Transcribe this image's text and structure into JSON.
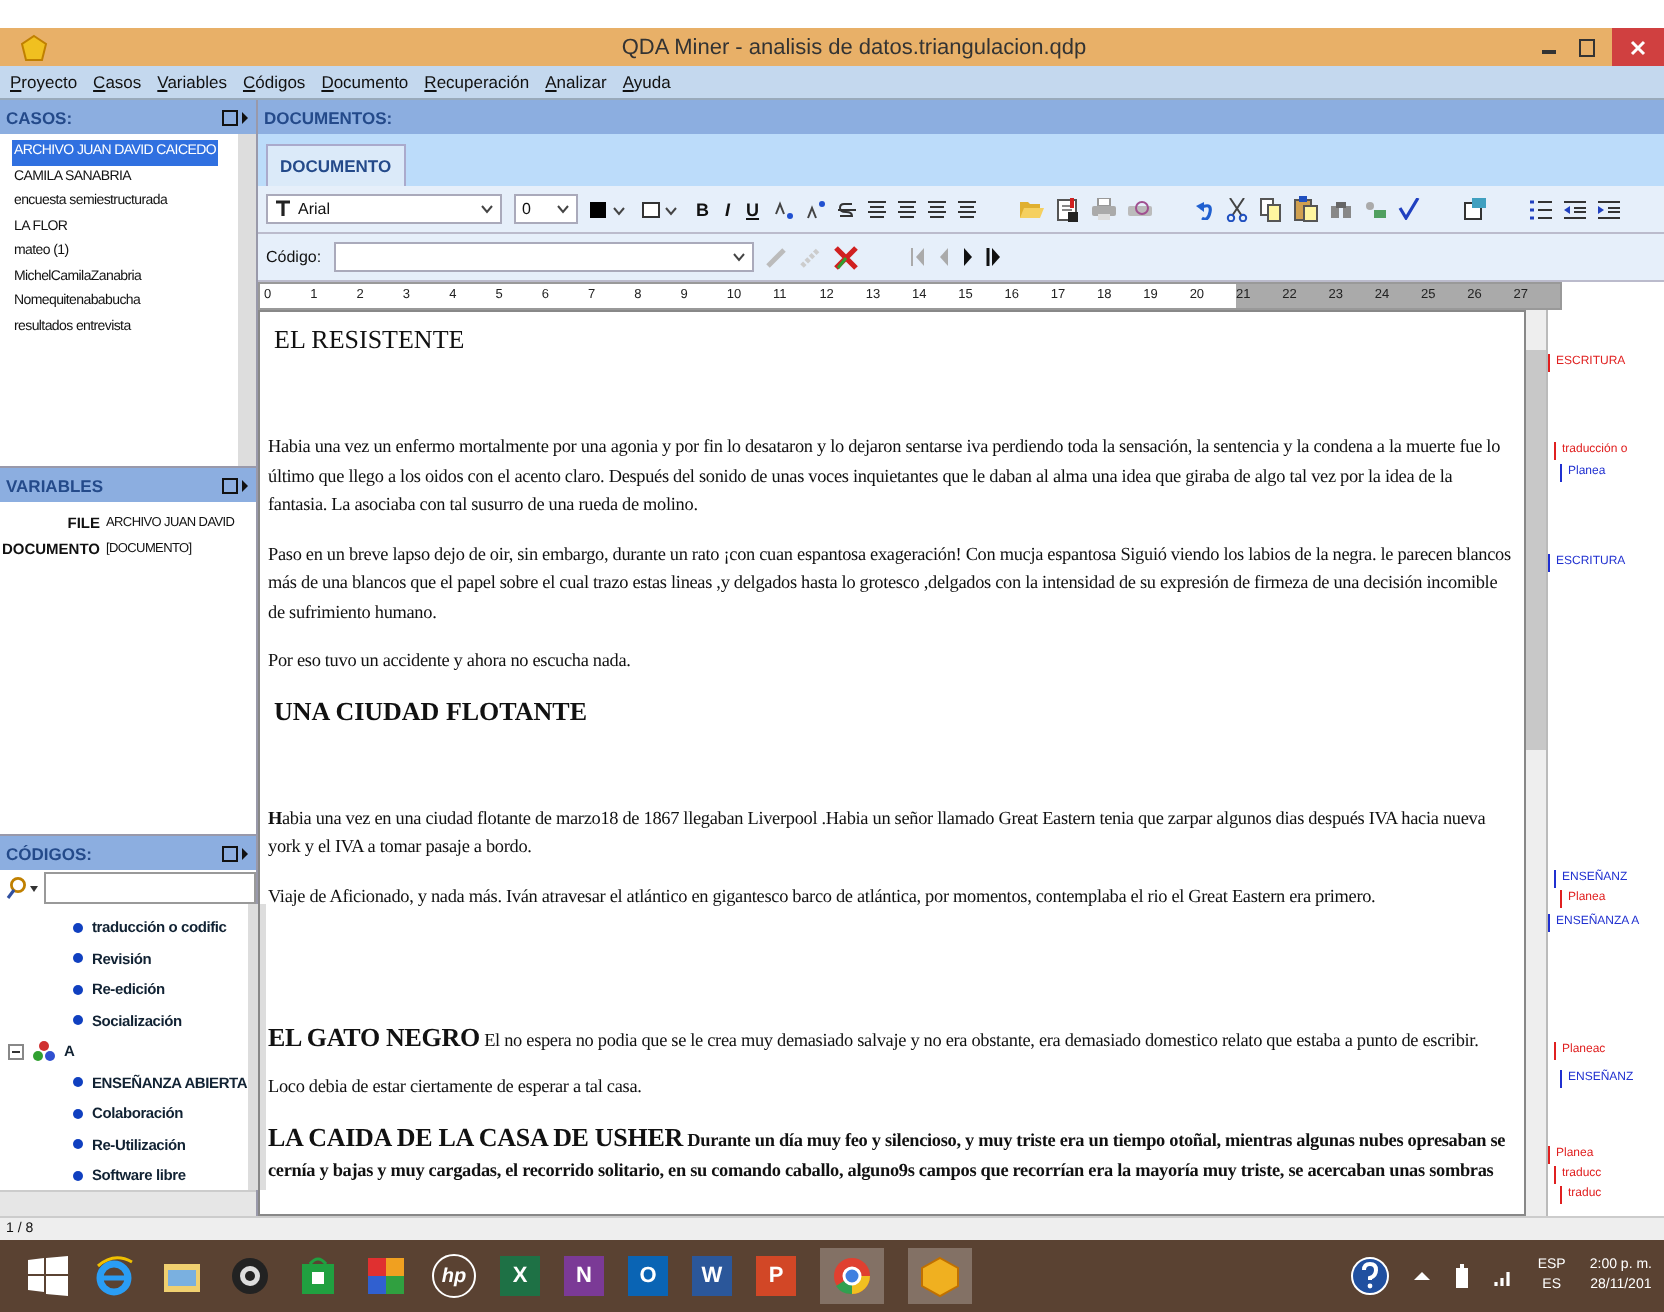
{
  "window": {
    "title": "QDA Miner - analisis de datos.triangulacion.qdp"
  },
  "menu": [
    "Proyecto",
    "Casos",
    "Variables",
    "Códigos",
    "Documento",
    "Recuperación",
    "Analizar",
    "Ayuda"
  ],
  "cases": {
    "title": "CASOS:",
    "items": [
      {
        "label": "ARCHIVO JUAN DAVID CAICEDO",
        "selected": true
      },
      {
        "label": "CAMILA SANABRIA",
        "selected": false
      },
      {
        "label": "encuesta semiestructurada",
        "selected": false
      },
      {
        "label": "LA FLOR",
        "selected": false
      },
      {
        "label": "mateo (1)",
        "selected": false
      },
      {
        "label": "MichelCamilaZanabria",
        "selected": false
      },
      {
        "label": "Nomequitenababucha",
        "selected": false
      },
      {
        "label": "resultados entrevista",
        "selected": false
      }
    ]
  },
  "variables": {
    "title": "VARIABLES",
    "rows": [
      {
        "name": "FILE",
        "value": "ARCHIVO JUAN DAVID"
      },
      {
        "name": "DOCUMENTO",
        "value": "[DOCUMENTO]"
      }
    ]
  },
  "codes": {
    "title": "CÓDIGOS:",
    "items": [
      {
        "label": "traducción o codific",
        "kind": "code"
      },
      {
        "label": "Revisión",
        "kind": "code"
      },
      {
        "label": "Re-edición",
        "kind": "code"
      },
      {
        "label": "Socialización",
        "kind": "code"
      },
      {
        "label": "A",
        "kind": "category",
        "expanded": true,
        "children": [
          {
            "label": "ENSEÑANZA ABIERTA",
            "kind": "code"
          },
          {
            "label": "Colaboración",
            "kind": "code"
          },
          {
            "label": "Re-Utilización",
            "kind": "code"
          },
          {
            "label": "Software libre",
            "kind": "code"
          }
        ]
      }
    ]
  },
  "documents": {
    "title": "DOCUMENTOS:",
    "tabs": [
      {
        "label": "DOCUMENTO",
        "selected": true
      }
    ]
  },
  "toolbar": {
    "font": "Arial",
    "size": "0",
    "format_buttons": [
      "B",
      "I",
      "U"
    ],
    "code_label": "Código:"
  },
  "ruler": [
    {
      "label": "0",
      "shaded": false
    },
    {
      "label": "1",
      "shaded": false
    },
    {
      "label": "2",
      "shaded": false
    },
    {
      "label": "3",
      "shaded": false
    },
    {
      "label": "4",
      "shaded": false
    },
    {
      "label": "5",
      "shaded": false
    },
    {
      "label": "6",
      "shaded": false
    },
    {
      "label": "7",
      "shaded": false
    },
    {
      "label": "8",
      "shaded": false
    },
    {
      "label": "9",
      "shaded": false
    },
    {
      "label": "10",
      "shaded": false
    },
    {
      "label": "11",
      "shaded": false
    },
    {
      "label": "12",
      "shaded": false
    },
    {
      "label": "13",
      "shaded": false
    },
    {
      "label": "14",
      "shaded": false
    },
    {
      "label": "15",
      "shaded": false
    },
    {
      "label": "16",
      "shaded": false
    },
    {
      "label": "17",
      "shaded": false
    },
    {
      "label": "18",
      "shaded": false
    },
    {
      "label": "19",
      "shaded": false
    },
    {
      "label": "20",
      "shaded": false
    },
    {
      "label": "21",
      "shaded": true
    },
    {
      "label": "22",
      "shaded": true
    },
    {
      "label": "23",
      "shaded": true
    },
    {
      "label": "24",
      "shaded": true
    },
    {
      "label": "25",
      "shaded": true
    },
    {
      "label": "26",
      "shaded": true
    },
    {
      "label": "27",
      "shaded": true
    }
  ],
  "paragraphs": [
    {
      "kind": "title",
      "text": "EL RESISTENTE"
    },
    {
      "kind": "text",
      "text": "Habia una vez un enfermo mortalmente  por una agonia y por fin lo desataron y lo dejaron sentarse iva perdiendo toda la sensación, la sentencia y la condena a la muerte fue lo último que llego a los oidos  con el acento claro. Después del sonido de unas voces inquietantes que le daban al alma una idea que giraba de algo tal vez por la idea de la fantasia. La asociaba con tal susurro de una rueda de molino."
    },
    {
      "kind": "text",
      "text": "Paso en un breve lapso dejo de oir, sin embargo, durante un rato ¡con cuan espantosa exageración! Con mucja espantosa Siguió viendo los labios de la negra. le parecen blancos más de una  blancos que el papel  sobre el cual trazo estas lineas ,y delgados hasta lo grotesco ,delgados con la intensidad de su expresión de firmeza de una decisión incomible de sufrimiento humano."
    },
    {
      "kind": "text",
      "text": "Por eso tuvo un accidente y ahora no escucha nada."
    },
    {
      "kind": "heading",
      "text": "UNA CIUDAD FLOTANTE"
    },
    {
      "kind": "text",
      "text": "**H**abia una vez en una ciudad flotante de marzo18 de 1867 llegaban Liverpool .Habia un señor llamado Great Eastern tenia que zarpar algunos dias después IVA hacia nueva york  y el IVA a tomar pasaje a bordo."
    },
    {
      "kind": "text",
      "text": "Viaje de Aficionado, y nada más. Iván atravesar el atlántico en gigantesco barco de atlántica, por momentos, contemplaba el rio el Great Eastern era primero."
    },
    {
      "kind": "lead",
      "lead": "EL GATO NEGRO",
      "text": "El no espera no podia que se le crea muy demasiado salvaje  y no era obstante, era demasiado domestico relato que estaba a punto de escribir.",
      "bold": false
    },
    {
      "kind": "text",
      "text": "Loco debia de estar ciertamente de esperar a tal casa."
    },
    {
      "kind": "lead",
      "lead": "LA CAIDA DE LA CASA DE USHER",
      "text": "Durante un día muy feo y silencioso, y muy triste era un tiempo otoñal, mientras algunas nubes opresaban se cernía y bajas y muy cargadas, el recorrido solitario, en su comando caballo, alguno9s campos que recorrían era la mayoría muy triste, se acercaban unas sombras",
      "bold": true
    }
  ],
  "code_marks": [
    {
      "label": "ESCRITURA",
      "color": "#e02020"
    },
    {
      "label": "traducción o",
      "color": "#e02020"
    },
    {
      "label": "Planea",
      "color": "#2030d0"
    },
    {
      "label": "ESCRITURA",
      "color": "#2030d0"
    },
    {
      "label": "ENSEÑANZ",
      "color": "#2030d0"
    },
    {
      "label": "Planea",
      "color": "#e02020"
    },
    {
      "label": "ENSEÑANZA A",
      "color": "#2030d0"
    },
    {
      "label": "Planeac",
      "color": "#e02020"
    },
    {
      "label": "ENSEÑANZ",
      "color": "#2030d0"
    },
    {
      "label": "Planea",
      "color": "#e02020"
    },
    {
      "label": "traducc",
      "color": "#e02020"
    },
    {
      "label": "traduc",
      "color": "#e02020"
    }
  ],
  "status_bar": "1 / 8",
  "taskbar": {
    "apps": [
      {
        "kind": "browser"
      },
      {
        "kind": "folder"
      },
      {
        "kind": "camera"
      },
      {
        "kind": "store"
      },
      {
        "kind": "puzzle"
      },
      {
        "kind": "hp",
        "text": "hp"
      },
      {
        "kind": "tile",
        "text": "X",
        "color": "#1e7145"
      },
      {
        "kind": "tile",
        "text": "N",
        "color": "#7b3a96"
      },
      {
        "kind": "tile",
        "text": "O",
        "color": "#0a64b4"
      },
      {
        "kind": "tile",
        "text": "W",
        "color": "#2b579a"
      },
      {
        "kind": "tile",
        "text": "P",
        "color": "#d24726"
      },
      {
        "kind": "chrome"
      },
      {
        "kind": "qda"
      }
    ],
    "language": "ESP",
    "layout": "ES",
    "time": "2:00 p. m.",
    "date": "28/11/201"
  }
}
